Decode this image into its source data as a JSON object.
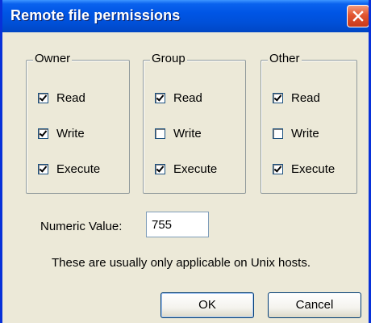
{
  "window": {
    "title": "Remote file permissions"
  },
  "groups": [
    {
      "legend": "Owner",
      "checkboxes": [
        {
          "label": "Read",
          "checked": true
        },
        {
          "label": "Write",
          "checked": true
        },
        {
          "label": "Execute",
          "checked": true
        }
      ]
    },
    {
      "legend": "Group",
      "checkboxes": [
        {
          "label": "Read",
          "checked": true
        },
        {
          "label": "Write",
          "checked": false
        },
        {
          "label": "Execute",
          "checked": true
        }
      ]
    },
    {
      "legend": "Other",
      "checkboxes": [
        {
          "label": "Read",
          "checked": true
        },
        {
          "label": "Write",
          "checked": false
        },
        {
          "label": "Execute",
          "checked": true
        }
      ]
    }
  ],
  "numeric": {
    "label": "Numeric Value:",
    "value": "755"
  },
  "info": "These are usually only applicable on Unix hosts.",
  "buttons": {
    "ok": "OK",
    "cancel": "Cancel"
  },
  "colors": {
    "title_bar": "#0055e5",
    "dialog_bg": "#ece9d8",
    "close_button": "#e2552f"
  },
  "icons": {
    "close": "close-icon"
  }
}
